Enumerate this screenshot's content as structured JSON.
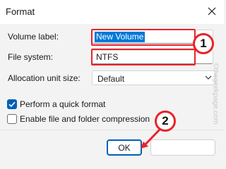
{
  "window": {
    "title": "Format",
    "close_icon": "close-icon"
  },
  "form": {
    "volume_label": {
      "label": "Volume label:",
      "value": "New Volume"
    },
    "file_system": {
      "label": "File system:",
      "value": "NTFS"
    },
    "allocation_unit_size": {
      "label": "Allocation unit size:",
      "value": "Default"
    },
    "quick_format": {
      "label": "Perform a quick format",
      "checked": true
    },
    "compression": {
      "label": "Enable file and folder compression",
      "checked": false
    }
  },
  "buttons": {
    "ok_label": "OK"
  },
  "annotations": {
    "step1": "1",
    "step2": "2",
    "highlight_color": "#e8232a"
  },
  "watermark": "©thegeekpage.com",
  "colors": {
    "accent": "#005fb8",
    "selection": "#0078d7"
  }
}
